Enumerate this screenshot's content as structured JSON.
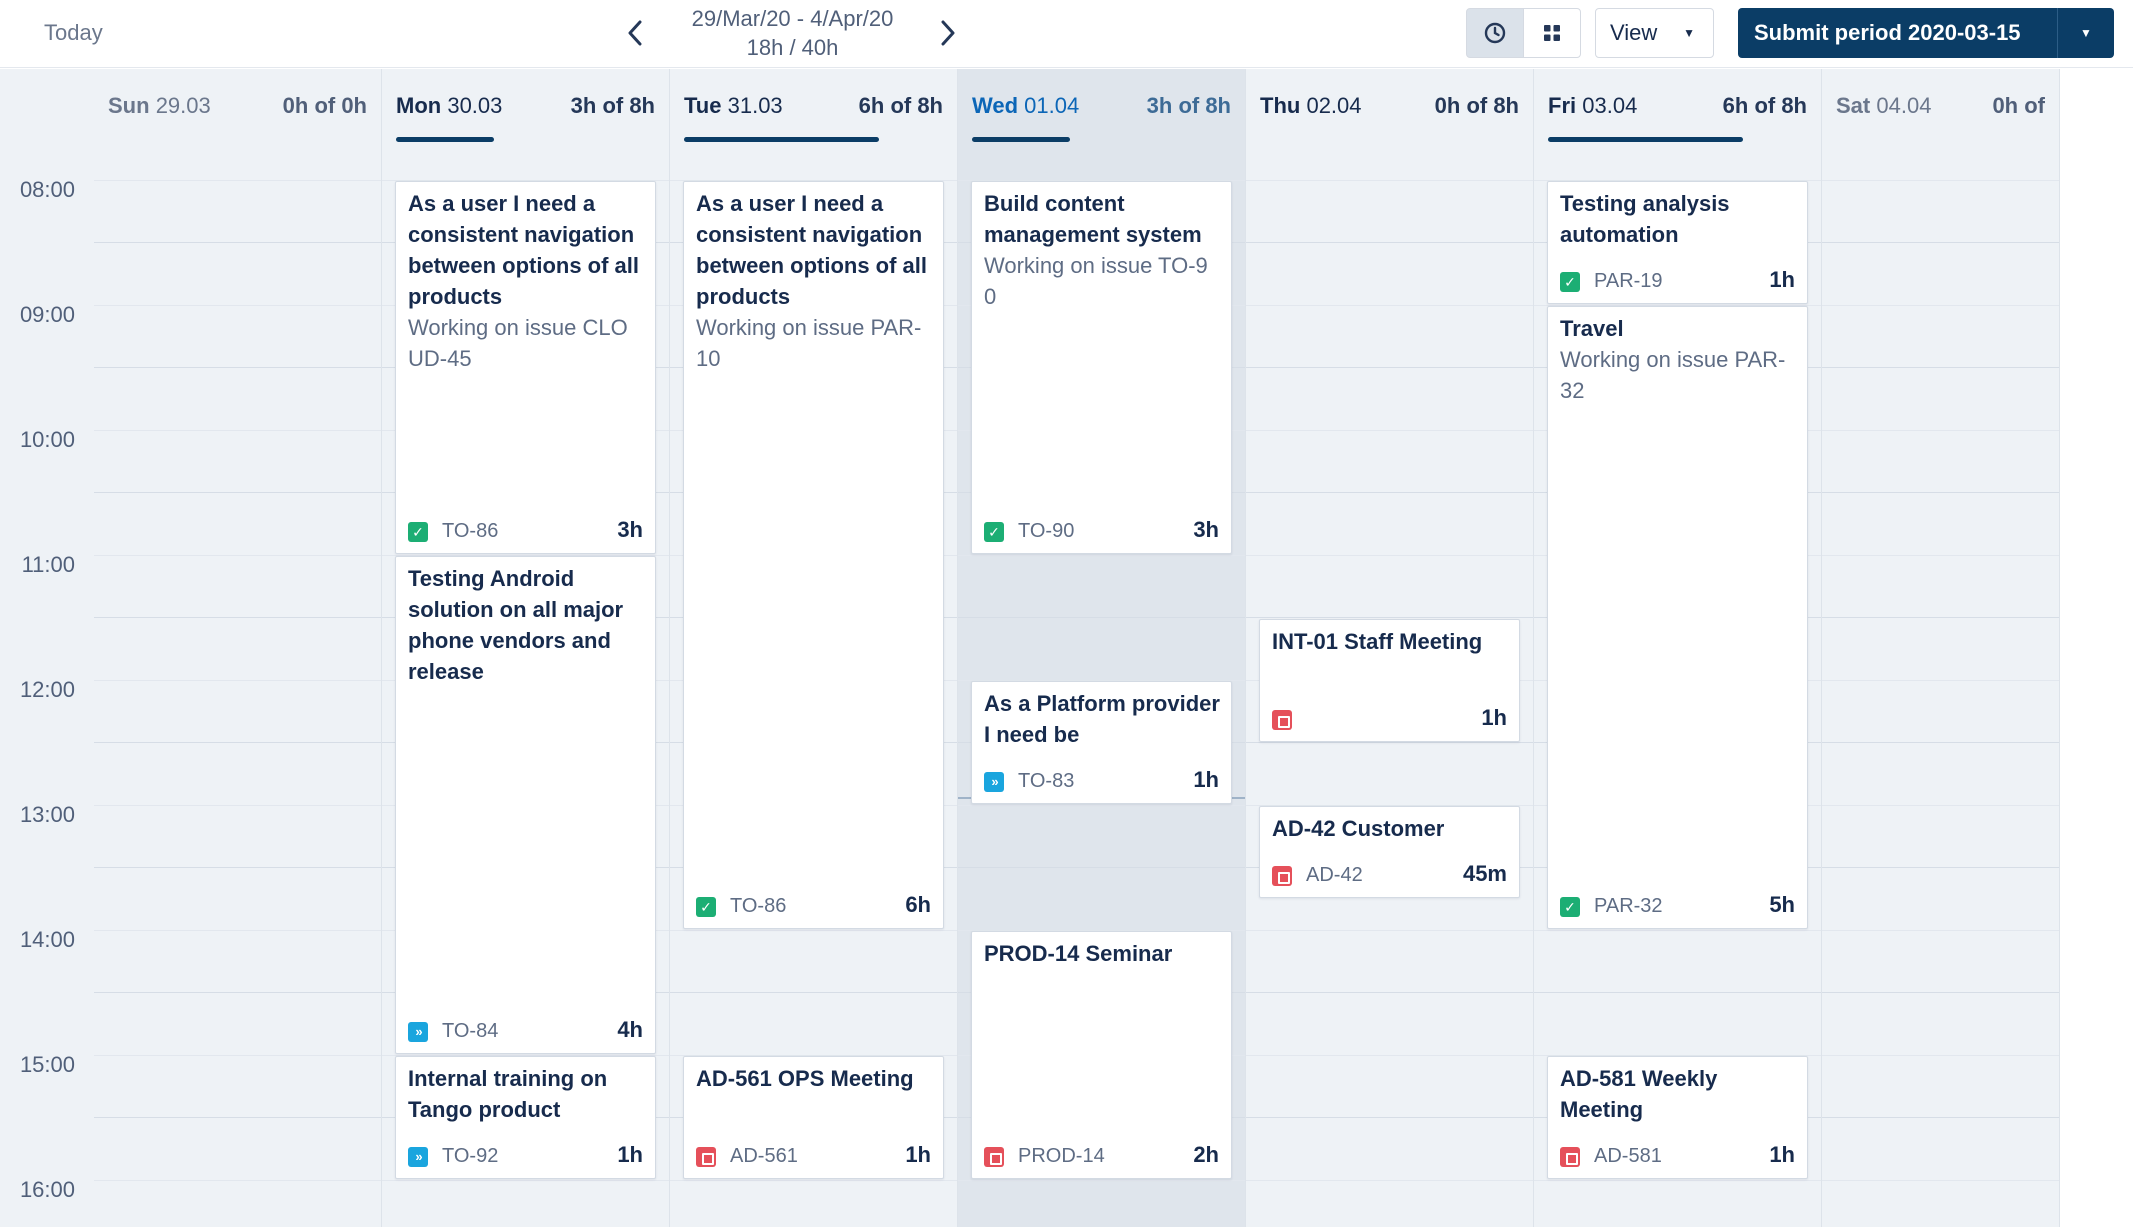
{
  "toolbar": {
    "today_label": "Today",
    "prev_icon": "chevron-left-icon",
    "next_icon": "chevron-right-icon",
    "period_range": "29/Mar/20 - 4/Apr/20",
    "period_hours": "18h / 40h",
    "clock_view_icon": "clock-icon",
    "grid_view_icon": "grid-icon",
    "view_label": "View",
    "submit_label": "Submit period 2020-03-15",
    "accent_color": "#0b3d66"
  },
  "hours": [
    "08:00",
    "09:00",
    "10:00",
    "11:00",
    "12:00",
    "13:00",
    "14:00",
    "15:00",
    "16:00"
  ],
  "days": [
    {
      "dow": "Sun",
      "date": "29.03",
      "hours_text": "0h of 0h",
      "progress": 0
    },
    {
      "dow": "Mon",
      "date": "30.03",
      "hours_text": "3h of 8h",
      "progress": 0.375
    },
    {
      "dow": "Tue",
      "date": "31.03",
      "hours_text": "6h of 8h",
      "progress": 0.75
    },
    {
      "dow": "Wed",
      "date": "01.04",
      "hours_text": "3h of 8h",
      "progress": 0.375
    },
    {
      "dow": "Thu",
      "date": "02.04",
      "hours_text": "0h of 8h",
      "progress": 0
    },
    {
      "dow": "Fri",
      "date": "03.04",
      "hours_text": "6h of 8h",
      "progress": 0.75
    },
    {
      "dow": "Sat",
      "date": "04.04",
      "hours_text": "0h of",
      "progress": 0
    }
  ],
  "worklogs": [
    {
      "day": 1,
      "start": "08:00",
      "end": "11:00",
      "title": "As a user I need a consistent navigation between options of all products",
      "desc": "Working on issue CLOUD-45",
      "issue_type": "task",
      "key": "TO-86",
      "duration": "3h"
    },
    {
      "day": 1,
      "start": "11:00",
      "end": "15:00",
      "title": "Testing Android solution on all major phone vendors and release",
      "desc": "",
      "issue_type": "story",
      "key": "TO-84",
      "duration": "4h"
    },
    {
      "day": 1,
      "start": "15:00",
      "end": "16:00",
      "title": "Internal training on Tango product",
      "desc": "",
      "issue_type": "story",
      "key": "TO-92",
      "duration": "1h"
    },
    {
      "day": 2,
      "start": "08:00",
      "end": "14:00",
      "title": "As a user I need a consistent navigation between options of all products",
      "desc": "Working on issue PAR-10",
      "issue_type": "task",
      "key": "TO-86",
      "duration": "6h"
    },
    {
      "day": 2,
      "start": "15:00",
      "end": "16:00",
      "title": "AD-561 OPS Meeting",
      "desc": "",
      "issue_type": "bug",
      "key": "AD-561",
      "duration": "1h"
    },
    {
      "day": 3,
      "start": "08:00",
      "end": "11:00",
      "title": "Build content management system",
      "desc": "Working on issue TO-90",
      "issue_type": "task",
      "key": "TO-90",
      "duration": "3h"
    },
    {
      "day": 3,
      "start": "12:00",
      "end": "13:00",
      "title": "As a Platform provider I need be",
      "desc": "",
      "issue_type": "story",
      "key": "TO-83",
      "duration": "1h"
    },
    {
      "day": 3,
      "start": "14:00",
      "end": "16:00",
      "title": "PROD-14 Seminar",
      "desc": "",
      "issue_type": "bug",
      "key": "PROD-14",
      "duration": "2h"
    },
    {
      "day": 4,
      "start": "11:30",
      "end": "12:30",
      "title": "INT-01 Staff Meeting",
      "desc": "",
      "issue_type": "bug",
      "key": "",
      "duration": "1h"
    },
    {
      "day": 4,
      "start": "13:00",
      "end": "13:45",
      "title": "AD-42 Customer",
      "desc": "",
      "issue_type": "bug",
      "key": "AD-42",
      "duration": "45m"
    },
    {
      "day": 5,
      "start": "08:00",
      "end": "09:00",
      "title": "Testing analysis automation",
      "desc": "",
      "issue_type": "task",
      "key": "PAR-19",
      "duration": "1h"
    },
    {
      "day": 5,
      "start": "09:00",
      "end": "14:00",
      "title": "Travel",
      "desc": "Working on issue PAR-32",
      "issue_type": "task",
      "key": "PAR-32",
      "duration": "5h"
    },
    {
      "day": 5,
      "start": "15:00",
      "end": "16:00",
      "title": "AD-581 Weekly Meeting",
      "desc": "",
      "issue_type": "bug",
      "key": "AD-581",
      "duration": "1h"
    }
  ]
}
